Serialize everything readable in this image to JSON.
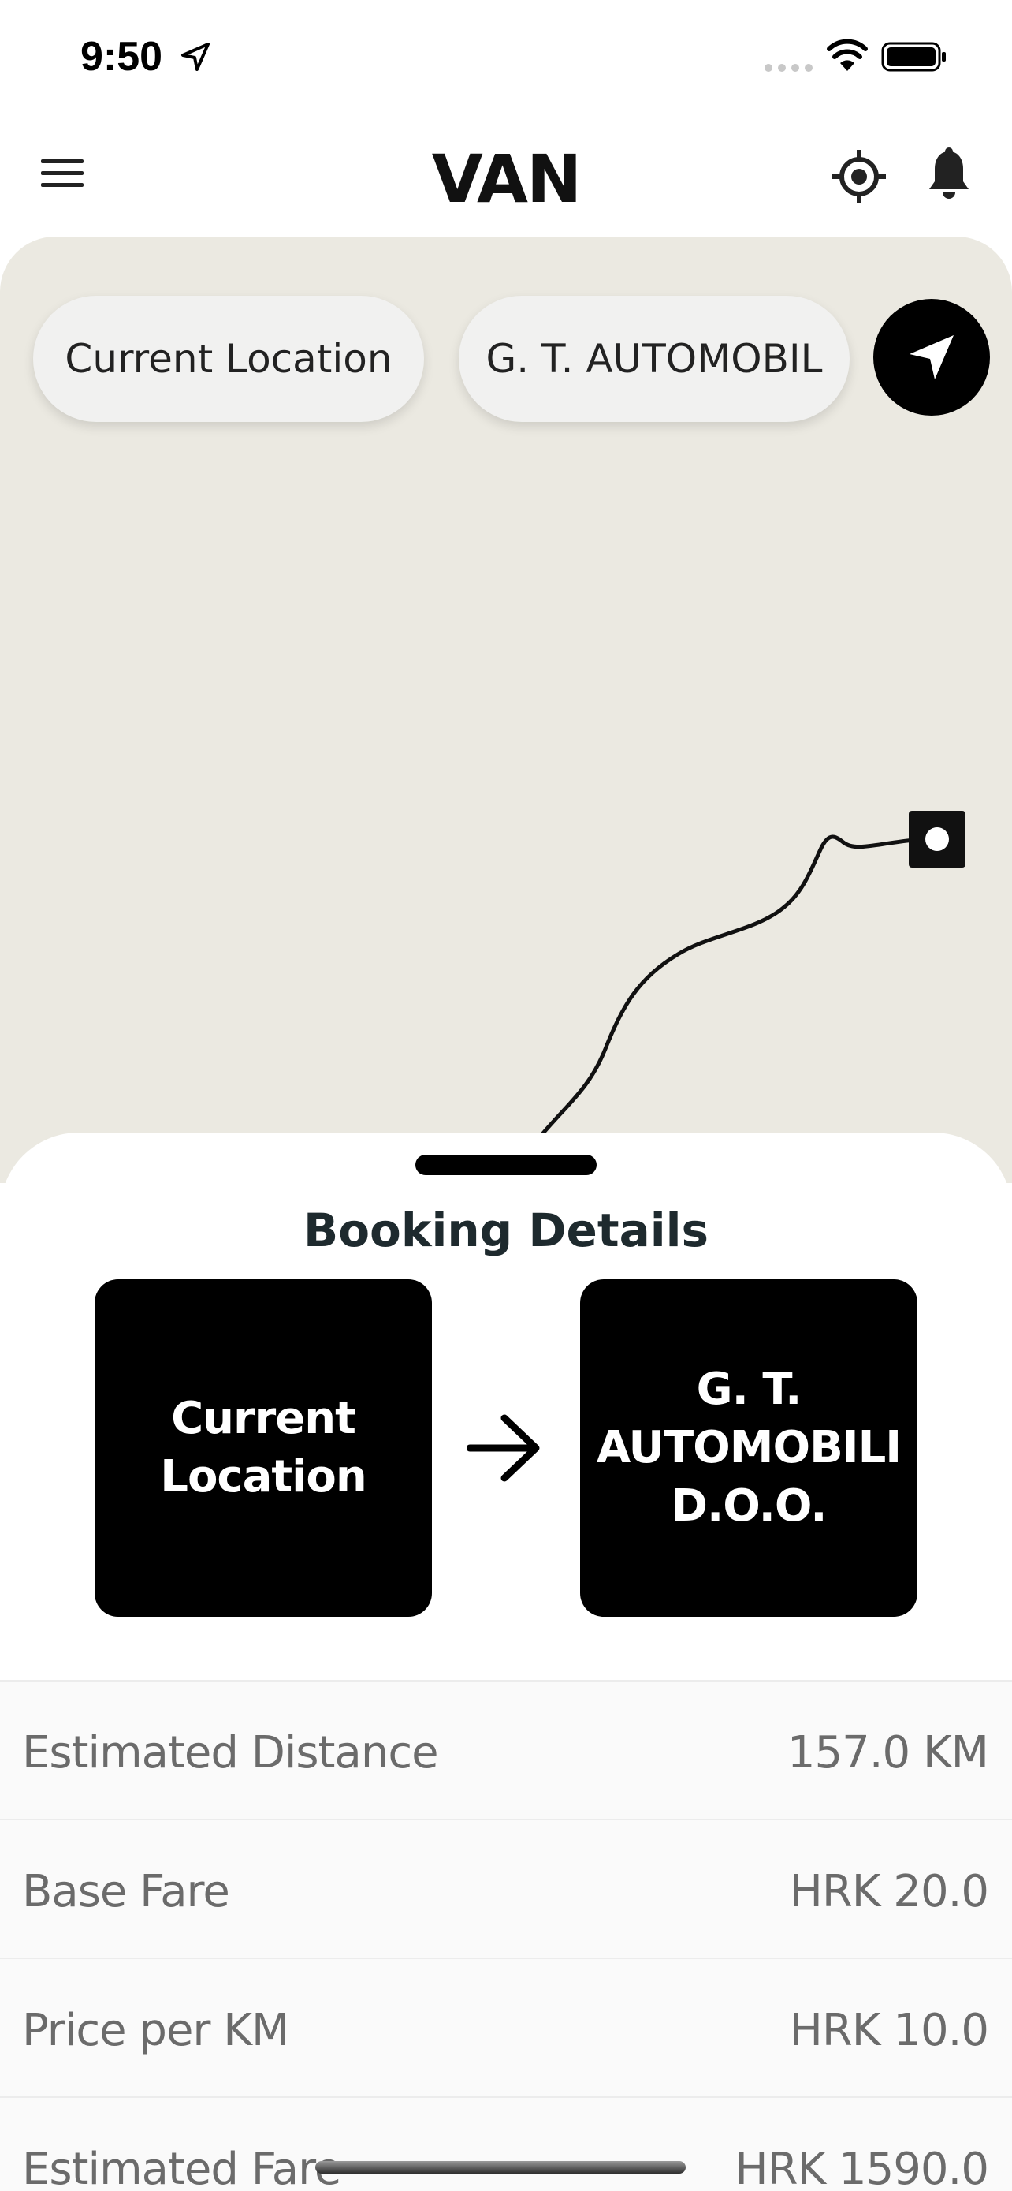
{
  "status_bar": {
    "time": "9:50"
  },
  "header": {
    "logo": "VAN"
  },
  "map": {
    "from_value": "Current Location",
    "to_value": "G. T. AUTOMOBIL"
  },
  "booking": {
    "title": "Booking Details",
    "from_box": "Current Location",
    "to_box": "G. T. AUTOMOBILI D.O.O.",
    "rows": [
      {
        "label": "Estimated Distance",
        "value": "157.0 KM"
      },
      {
        "label": "Base Fare",
        "value": "HRK 20.0"
      },
      {
        "label": "Price per KM",
        "value": "HRK 10.0"
      },
      {
        "label": "Estimated Fare",
        "value": "HRK 1590.0"
      }
    ]
  },
  "icons": {
    "menu": "hamburger-menu-icon",
    "target": "gps-target-icon",
    "bell": "notification-bell-icon",
    "navigate": "navigation-arrow-icon",
    "arrow": "arrow-right-icon"
  },
  "colors": {
    "map_background": "#ebe9e1",
    "accent": "#000000",
    "pill_background": "#f1f1f0",
    "title_color": "#1e2a2e",
    "row_text": "#6b6b6b"
  }
}
